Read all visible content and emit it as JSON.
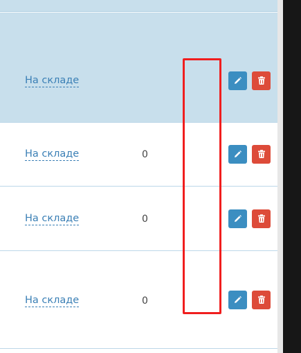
{
  "rows": [
    {
      "status_label": "На складе",
      "quantity": "",
      "edit_label": "",
      "delete_label": ""
    },
    {
      "status_label": "На складе",
      "quantity": "0"
    },
    {
      "status_label": "На складе",
      "quantity": "0"
    },
    {
      "status_label": "На складе",
      "quantity": "0"
    }
  ],
  "icons": {
    "edit": "pencil-icon",
    "delete": "trash-icon"
  },
  "colors": {
    "highlight_row": "#c8dfec",
    "link": "#3a7fb5",
    "edit_button": "#3b8ec1",
    "delete_button": "#dd4b39",
    "selection_outline": "#f01e1e"
  }
}
